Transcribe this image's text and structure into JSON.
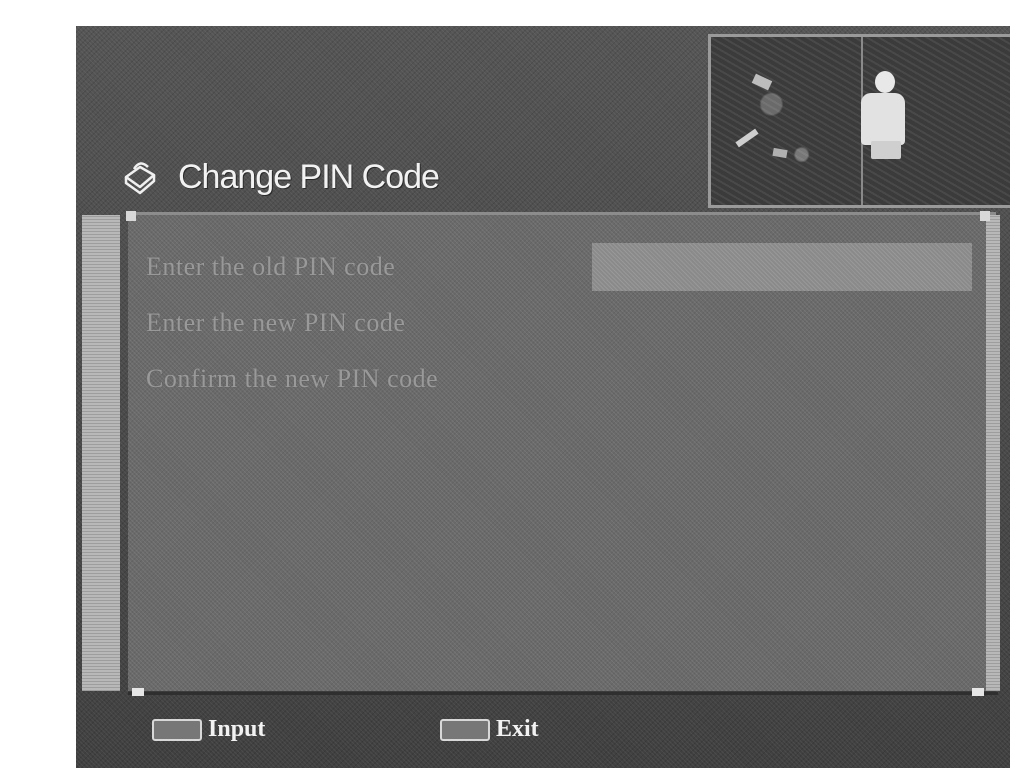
{
  "header": {
    "title": "Change PIN Code",
    "icon": "lock-icon"
  },
  "form": {
    "rows": [
      {
        "label": "Enter the old PIN code",
        "value": ""
      },
      {
        "label": "Enter the new PIN code",
        "value": ""
      },
      {
        "label": "Confirm the new PIN code",
        "value": ""
      }
    ],
    "selected_row_index": 0
  },
  "footer": {
    "hints": [
      {
        "key_icon": "ok-key-icon",
        "label": "Input"
      },
      {
        "key_icon": "exit-key-icon",
        "label": "Exit"
      }
    ]
  },
  "preview": {
    "icon": "live-tv-preview"
  }
}
